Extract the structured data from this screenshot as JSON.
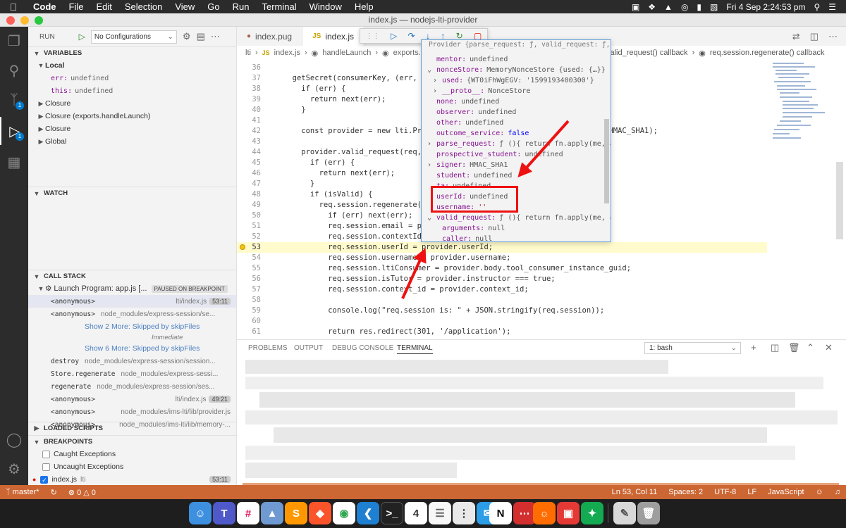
{
  "menubar": {
    "items": [
      "Code",
      "File",
      "Edit",
      "Selection",
      "View",
      "Go",
      "Run",
      "Terminal",
      "Window",
      "Help"
    ],
    "datetime": "Fri 4 Sep  2:24:53 pm"
  },
  "window": {
    "title": "index.js — nodejs-lti-provider"
  },
  "activitybar": {
    "scm_badge": "1",
    "debug_badge": "1"
  },
  "sidebar": {
    "run_label": "RUN",
    "config": "No Configurations",
    "variables_header": "VARIABLES",
    "local_label": "Local",
    "locals": [
      {
        "name": "err:",
        "value": "undefined"
      },
      {
        "name": "this:",
        "value": "undefined"
      }
    ],
    "scopes": [
      "Closure",
      "Closure (exports.handleLaunch)",
      "Closure",
      "Global"
    ],
    "watch_header": "WATCH",
    "callstack_header": "CALL STACK",
    "program": "Launch Program: app.js [...",
    "paused": "PAUSED ON BREAKPOINT",
    "frames": [
      {
        "name": "<anonymous>",
        "source": "lti/index.js",
        "line": "53:11"
      },
      {
        "name": "<anonymous>",
        "source": "node_modules/express-session/se...",
        "line": ""
      }
    ],
    "show_more_1": "Show 2 More: Skipped by skipFiles",
    "immediate": "Immediate",
    "show_more_2": "Show 6 More: Skipped by skipFiles",
    "frames2": [
      {
        "name": "destroy",
        "source": "node_modules/express-session/session...",
        "line": ""
      },
      {
        "name": "Store.regenerate",
        "source": "node_modules/express-sessi...",
        "line": ""
      },
      {
        "name": "regenerate",
        "source": "node_modules/express-session/ses...",
        "line": ""
      },
      {
        "name": "<anonymous>",
        "source": "lti/index.js",
        "line": "49:21"
      },
      {
        "name": "<anonymous>",
        "source": "node_modules/ims-lti/lib/provider.js",
        "line": ""
      },
      {
        "name": "<anonymous>",
        "source": "node_modules/ims-lti/lib/memory-...",
        "line": ""
      }
    ],
    "loaded_scripts_header": "LOADED SCRIPTS",
    "breakpoints_header": "BREAKPOINTS",
    "bp_caught": "Caught Exceptions",
    "bp_uncaught": "Uncaught Exceptions",
    "bp_file": "index.js",
    "bp_folder": "lti",
    "bp_line": "53:11"
  },
  "tabs": [
    {
      "label": "index.pug",
      "icon": "pug-icon"
    },
    {
      "label": "index.js",
      "icon": "js-icon"
    }
  ],
  "breadcrumb": {
    "parts": [
      "lti",
      "index.js",
      "handleLaunch",
      "exports..."
    ],
    "right_a": "valid_request() callback",
    "right_b": "req.session.regenerate() callback"
  },
  "code": {
    "lines": [
      {
        "n": "36",
        "t": ""
      },
      {
        "n": "37",
        "t": "  getSecret(consumerKey, (err, con"
      },
      {
        "n": "38",
        "t": "    if (err) {"
      },
      {
        "n": "39",
        "t": "      return next(err);"
      },
      {
        "n": "40",
        "t": "    }"
      },
      {
        "n": "41",
        "t": ""
      },
      {
        "n": "42",
        "t": "    const provider = new lti.Provi                                   lti.HMAC_SHA1);"
      },
      {
        "n": "43",
        "t": ""
      },
      {
        "n": "44",
        "t": "    provider.valid_request(req, (e"
      },
      {
        "n": "45",
        "t": "      if (err) {"
      },
      {
        "n": "46",
        "t": "        return next(err);"
      },
      {
        "n": "47",
        "t": "      }"
      },
      {
        "n": "48",
        "t": "      if (isValid) {"
      },
      {
        "n": "49",
        "t": "        req.session.regenerate(err"
      },
      {
        "n": "50",
        "t": "          if (err) next(err);"
      },
      {
        "n": "51",
        "t": "          req.session.email = provi"
      },
      {
        "n": "52",
        "t": "          req.session.contextId ="
      },
      {
        "n": "53",
        "t": "          req.session.userId = provider.userId;"
      },
      {
        "n": "54",
        "t": "          req.session.username = provider.username;"
      },
      {
        "n": "55",
        "t": "          req.session.ltiConsumer = provider.body.tool_consumer_instance_guid;"
      },
      {
        "n": "56",
        "t": "          req.session.isTutor = provider.instructor === true;"
      },
      {
        "n": "57",
        "t": "          req.session.context_id = provider.context_id;"
      },
      {
        "n": "58",
        "t": ""
      },
      {
        "n": "59",
        "t": "          console.log(\"req.session is: \" + JSON.stringify(req.session));"
      },
      {
        "n": "60",
        "t": ""
      },
      {
        "n": "61",
        "t": "          return res.redirect(301, '/application');"
      }
    ],
    "current_line": "53"
  },
  "hover": {
    "header": "Provider {parse_request: ƒ, valid_request: ƒ,...",
    "rows": [
      {
        "indent": 0,
        "tw": "",
        "key": "mentor:",
        "val": "undefined",
        "kind": "val"
      },
      {
        "indent": 0,
        "tw": "v",
        "key": "nonceStore:",
        "val": "MemoryNonceStore {used: {…}}",
        "kind": "val"
      },
      {
        "indent": 1,
        "tw": ">",
        "key": "used:",
        "val": "{WT0iFhWgEGV: '1599193400300'}",
        "kind": "val"
      },
      {
        "indent": 1,
        "tw": ">",
        "key": "__proto__:",
        "val": "NonceStore",
        "kind": "val"
      },
      {
        "indent": 0,
        "tw": "",
        "key": "none:",
        "val": "undefined",
        "kind": "val"
      },
      {
        "indent": 0,
        "tw": "",
        "key": "observer:",
        "val": "undefined",
        "kind": "val"
      },
      {
        "indent": 0,
        "tw": "",
        "key": "other:",
        "val": "undefined",
        "kind": "val"
      },
      {
        "indent": 0,
        "tw": "",
        "key": "outcome_service:",
        "val": "false",
        "kind": "bool"
      },
      {
        "indent": 0,
        "tw": ">",
        "key": "parse_request:",
        "val": "ƒ (){ return fn.apply(me, arg",
        "kind": "val"
      },
      {
        "indent": 0,
        "tw": "",
        "key": "prospective_student:",
        "val": "undefined",
        "kind": "val"
      },
      {
        "indent": 0,
        "tw": ">",
        "key": "signer:",
        "val": "HMAC_SHA1",
        "kind": "val"
      },
      {
        "indent": 0,
        "tw": "",
        "key": "student:",
        "val": "undefined",
        "kind": "val"
      },
      {
        "indent": 0,
        "tw": "",
        "key": "ta:",
        "val": "undefined",
        "kind": "val"
      },
      {
        "indent": 0,
        "tw": "",
        "key": "userId:",
        "val": "undefined",
        "kind": "val"
      },
      {
        "indent": 0,
        "tw": "",
        "key": "username:",
        "val": "''",
        "kind": "str"
      },
      {
        "indent": 0,
        "tw": "v",
        "key": "valid_request:",
        "val": "ƒ (){ return fn.apply(me, arg",
        "kind": "val"
      },
      {
        "indent": 1,
        "tw": "",
        "key": "arguments:",
        "val": "null",
        "kind": "val"
      },
      {
        "indent": 1,
        "tw": "",
        "key": "caller:",
        "val": "null",
        "kind": "val"
      }
    ]
  },
  "panel": {
    "tabs": [
      "PROBLEMS",
      "OUTPUT",
      "DEBUG CONSOLE",
      "TERMINAL"
    ],
    "active_tab": "TERMINAL",
    "terminal_select": "1: bash"
  },
  "statusbar": {
    "branch": "master*",
    "errors": "0",
    "warnings": "0",
    "position": "Ln 53, Col 11",
    "spaces": "Spaces: 2",
    "encoding": "UTF-8",
    "eol": "LF",
    "language": "JavaScript"
  },
  "dock": {
    "calendar_day": "4"
  },
  "colors": {
    "statusbar": "#cc6633",
    "annotation": "#e11111",
    "current_line": "#fffbcc",
    "accent": "#007acc"
  }
}
